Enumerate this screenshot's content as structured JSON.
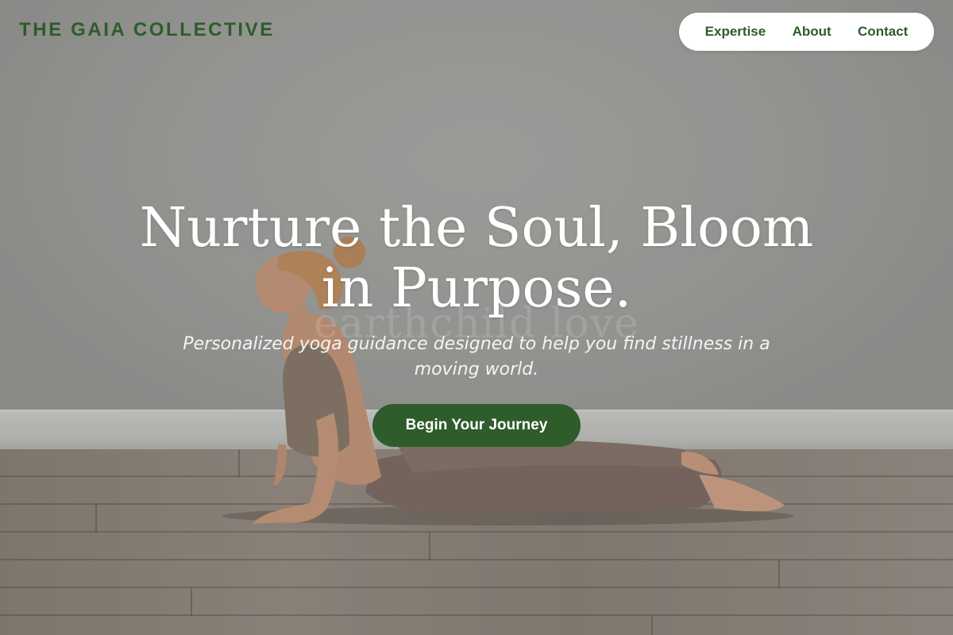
{
  "brand": {
    "name": "THE GAIA COLLECTIVE"
  },
  "nav": {
    "items": [
      {
        "label": "Expertise"
      },
      {
        "label": "About"
      },
      {
        "label": "Contact"
      }
    ]
  },
  "hero": {
    "headline": "Nurture the Soul, Bloom in Purpose.",
    "subheadline": "Personalized yoga guidance designed to help you find stillness in a moving world.",
    "cta_label": "Begin Your Journey",
    "background_icon": "yoga-cobra-pose-photo",
    "watermark": "earthchild love"
  },
  "colors": {
    "brand_green": "#2e5c2a",
    "nav_bg": "#ffffff",
    "headline": "#ffffff"
  }
}
